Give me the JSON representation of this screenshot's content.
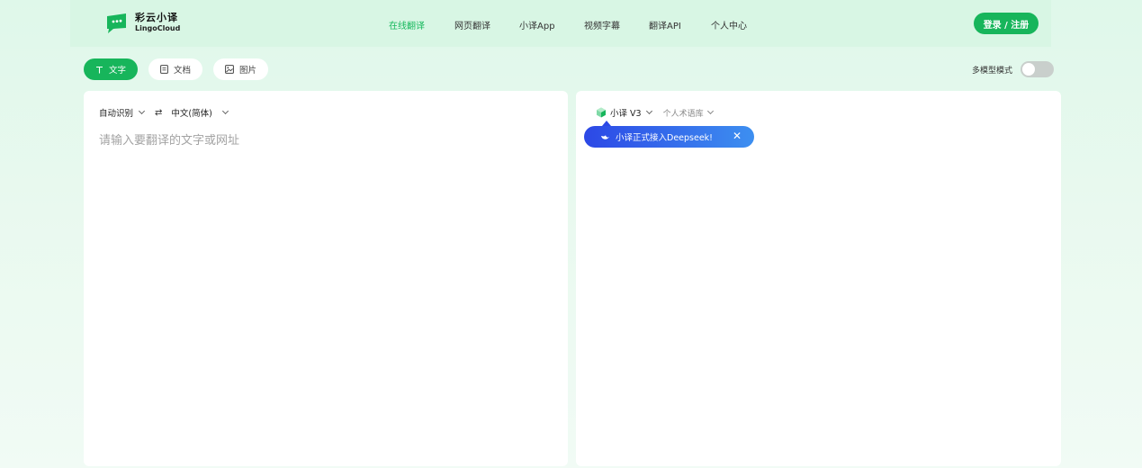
{
  "brand": {
    "name_cn": "彩云小译",
    "name_en": "LingoCloud",
    "color": "#17b55b"
  },
  "nav": {
    "items": [
      {
        "label": "在线翻译",
        "active": true
      },
      {
        "label": "网页翻译",
        "active": false
      },
      {
        "label": "小译App",
        "active": false
      },
      {
        "label": "视频字幕",
        "active": false
      },
      {
        "label": "翻译API",
        "active": false
      },
      {
        "label": "个人中心",
        "active": false
      }
    ],
    "login_label": "登录 / 注册"
  },
  "modes": {
    "text": {
      "label": "文字",
      "icon": "text-icon",
      "active": true
    },
    "document": {
      "label": "文档",
      "icon": "document-icon",
      "active": false
    },
    "image": {
      "label": "图片",
      "icon": "image-icon",
      "active": false
    }
  },
  "multi_model": {
    "label": "多模型模式",
    "enabled": false
  },
  "source": {
    "detect_label": "自动识别",
    "target_lang": "中文(简体)",
    "placeholder": "请输入要翻译的文字或网址",
    "value": ""
  },
  "result": {
    "model_label": "小译 V3",
    "corpus_label": "个人术语库",
    "promo_text": "小译正式接入Deepseek!"
  },
  "colors": {
    "accent": "#17b55b",
    "promo_start": "#2c48e6",
    "promo_end": "#3d8ff0"
  }
}
